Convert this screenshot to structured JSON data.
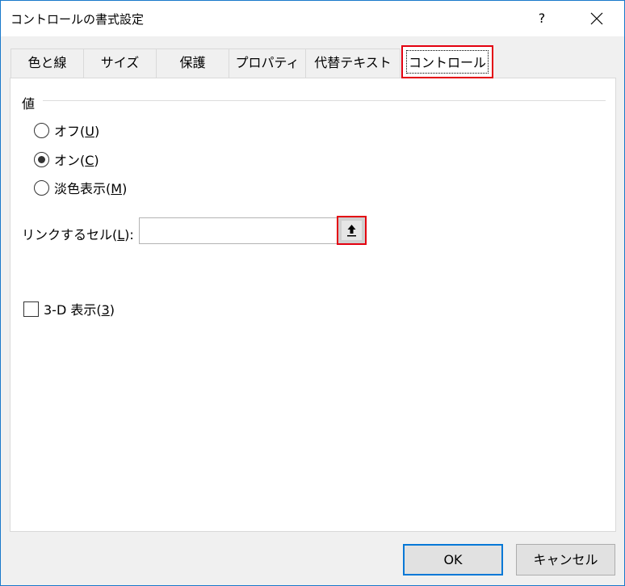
{
  "window": {
    "title": "コントロールの書式設定",
    "help_label": "?",
    "close_icon": "close-icon"
  },
  "tabs": [
    {
      "label": "色と線",
      "active": false
    },
    {
      "label": "サイズ",
      "active": false
    },
    {
      "label": "保護",
      "active": false
    },
    {
      "label": "プロパティ",
      "active": false
    },
    {
      "label": "代替テキスト",
      "active": false
    },
    {
      "label": "コントロール",
      "active": true
    }
  ],
  "value_group": {
    "label": "値",
    "options": [
      {
        "text": "オフ(",
        "accel": "U",
        "suffix": ")",
        "checked": false
      },
      {
        "text": "オン(",
        "accel": "C",
        "suffix": ")",
        "checked": true
      },
      {
        "text": "淡色表示(",
        "accel": "M",
        "suffix": ")",
        "checked": false
      }
    ]
  },
  "link_cell": {
    "label_text": "リンクするセル(",
    "label_accel": "L",
    "label_suffix": "):",
    "value": "",
    "button_icon": "collapse-dialog-icon"
  },
  "three_d": {
    "label_text": "3-D 表示(",
    "label_accel": "3",
    "label_suffix": ")",
    "checked": false
  },
  "buttons": {
    "ok": "OK",
    "cancel": "キャンセル"
  },
  "colors": {
    "highlight_red": "#e3000f",
    "accent_blue": "#0078d7"
  }
}
